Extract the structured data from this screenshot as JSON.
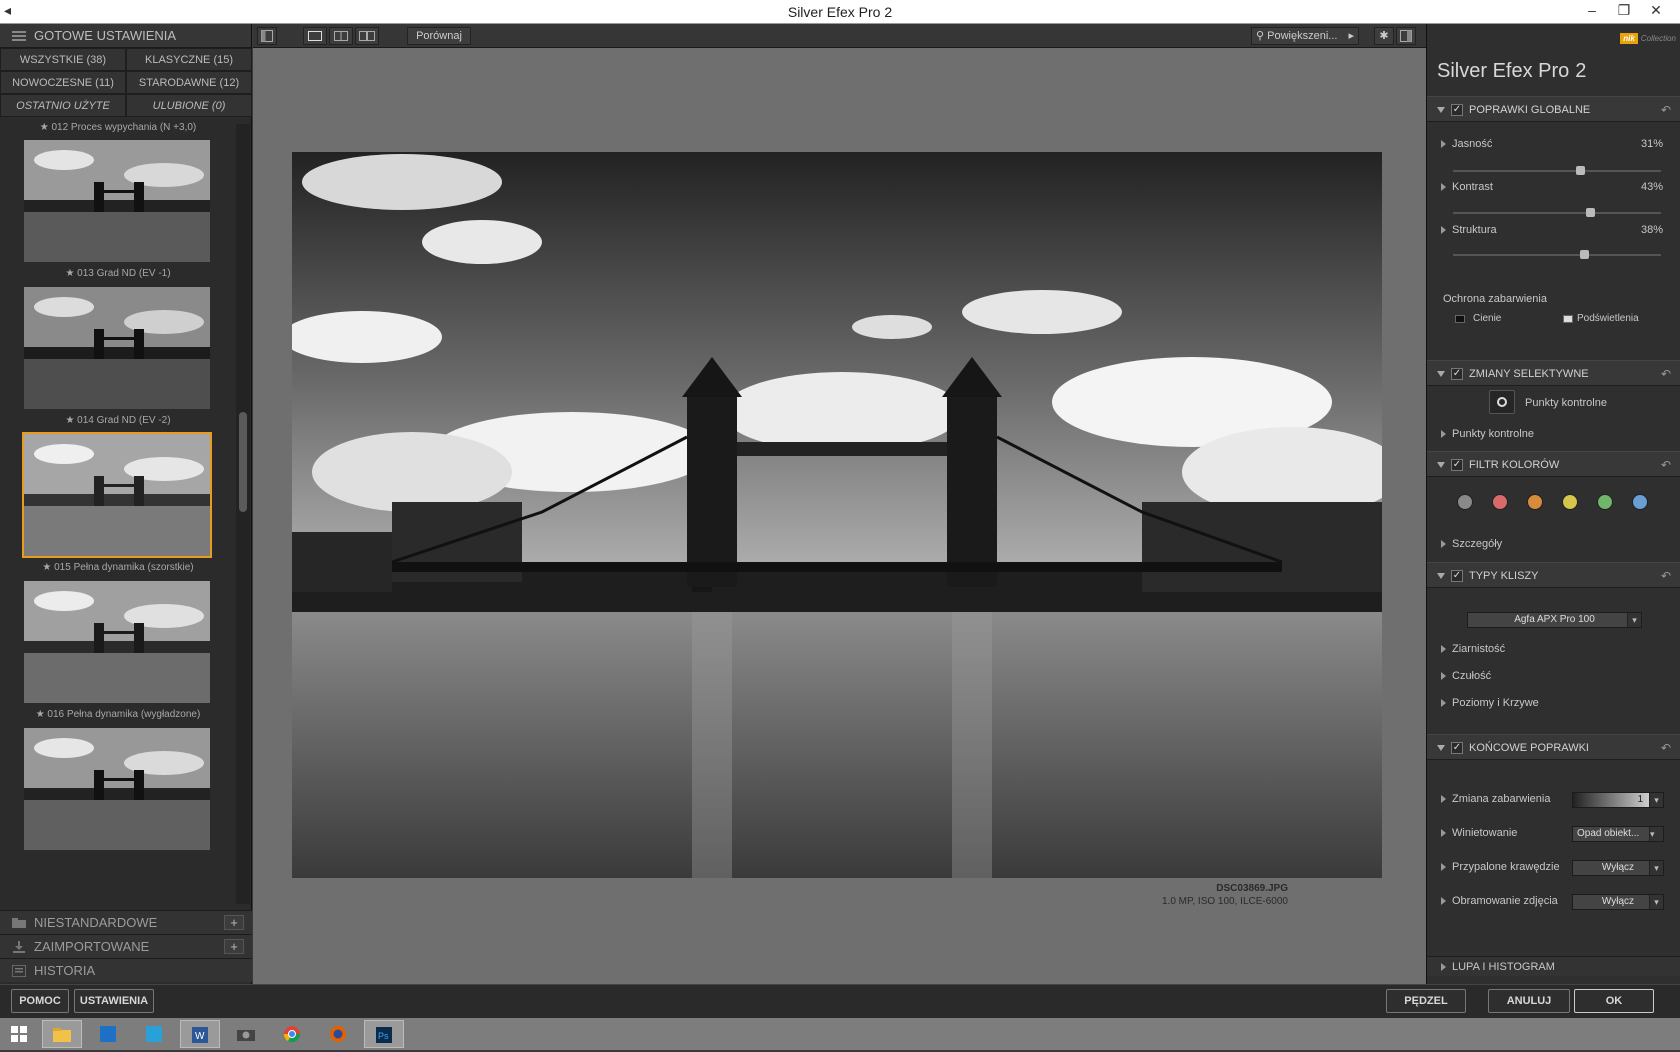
{
  "window": {
    "title": "Silver Efex Pro 2",
    "controls": [
      "–",
      "❐",
      "✕"
    ]
  },
  "left_panel": {
    "header": "GOTOWE USTAWIENIA",
    "filters": [
      "WSZYSTKIE (38)",
      "KLASYCZNE (15)",
      "NOWOCZESNE (11)",
      "STARODAWNE (12)",
      "OSTATNIO UŻYTE",
      "ULUBIONE (0)"
    ],
    "top_partial_label": "★ 012 Proces wypychania (N +3,0)",
    "presets": [
      {
        "label": "★ 013 Grad ND (EV -1)",
        "selected": false
      },
      {
        "label": "★ 014 Grad ND (EV -2)",
        "selected": false
      },
      {
        "label": "★ 015 Pełna dynamika (szorstkie)",
        "selected": true
      },
      {
        "label": "★ 016 Pełna dynamika (wygładzone)",
        "selected": false
      },
      {
        "label": "",
        "selected": false
      }
    ],
    "bottom_tabs": [
      "NIESTANDARDOWE",
      "ZAIMPORTOWANE",
      "HISTORIA"
    ],
    "plus": "+"
  },
  "toolbar": {
    "compare": "Porównaj",
    "zoom": "Powiększeni...",
    "zoom_arrow": "▸"
  },
  "image": {
    "filename": "DSC03869.JPG",
    "meta": "1.0 MP, ISO 100, ILCE-6000"
  },
  "right_panel": {
    "logo": "Silver Efex Pro",
    "logo_num": "2",
    "brand": "nik",
    "brand_suffix": "Collection",
    "global": {
      "title": "POPRAWKI GLOBALNE",
      "sliders": [
        {
          "label": "Jasność",
          "value": "31%",
          "level": 0.62
        },
        {
          "label": "Kontrast",
          "value": "43%",
          "level": 0.67
        },
        {
          "label": "Struktura",
          "value": "38%",
          "level": 0.64
        }
      ],
      "protection": "Ochrona zabarwienia",
      "shadows": "Cienie",
      "highlights": "Podświetlenia"
    },
    "selective": {
      "title": "ZMIANY SELEKTYWNE",
      "button": "Punkty kontrolne",
      "row": "Punkty kontrolne"
    },
    "color_filter": {
      "title": "FILTR KOLORÓW",
      "colors": [
        "#8a8a8a",
        "#d86a6a",
        "#d98b3c",
        "#d6c64a",
        "#6fb56a",
        "#6a9fd6"
      ],
      "details": "Szczegóły"
    },
    "film": {
      "title": "TYPY KLISZY",
      "selected": "Agfa APX Pro 100",
      "rows": [
        "Ziarnistość",
        "Czułość",
        "Poziomy i Krzywe"
      ]
    },
    "finishing": {
      "title": "KOŃCOWE POPRAWKI",
      "rows": [
        {
          "label": "Zmiana zabarwienia",
          "value": "1"
        },
        {
          "label": "Winietowanie",
          "value": "Opad obiekt..."
        },
        {
          "label": "Przypalone krawędzie",
          "value": "Wyłącz"
        },
        {
          "label": "Obramowanie zdjęcia",
          "value": "Wyłącz"
        }
      ]
    },
    "loupe": "LUPA I HISTOGRAM"
  },
  "actions": {
    "help": "POMOC",
    "settings": "USTAWIENIA",
    "brush": "PĘDZEL",
    "cancel": "ANULUJ",
    "ok": "OK"
  },
  "taskbar": {
    "icons": [
      "windows-icon",
      "explorer-icon",
      "app-icon",
      "store-icon",
      "word-icon",
      "camera-icon",
      "chrome-icon",
      "firefox-icon",
      "photoshop-icon"
    ]
  }
}
